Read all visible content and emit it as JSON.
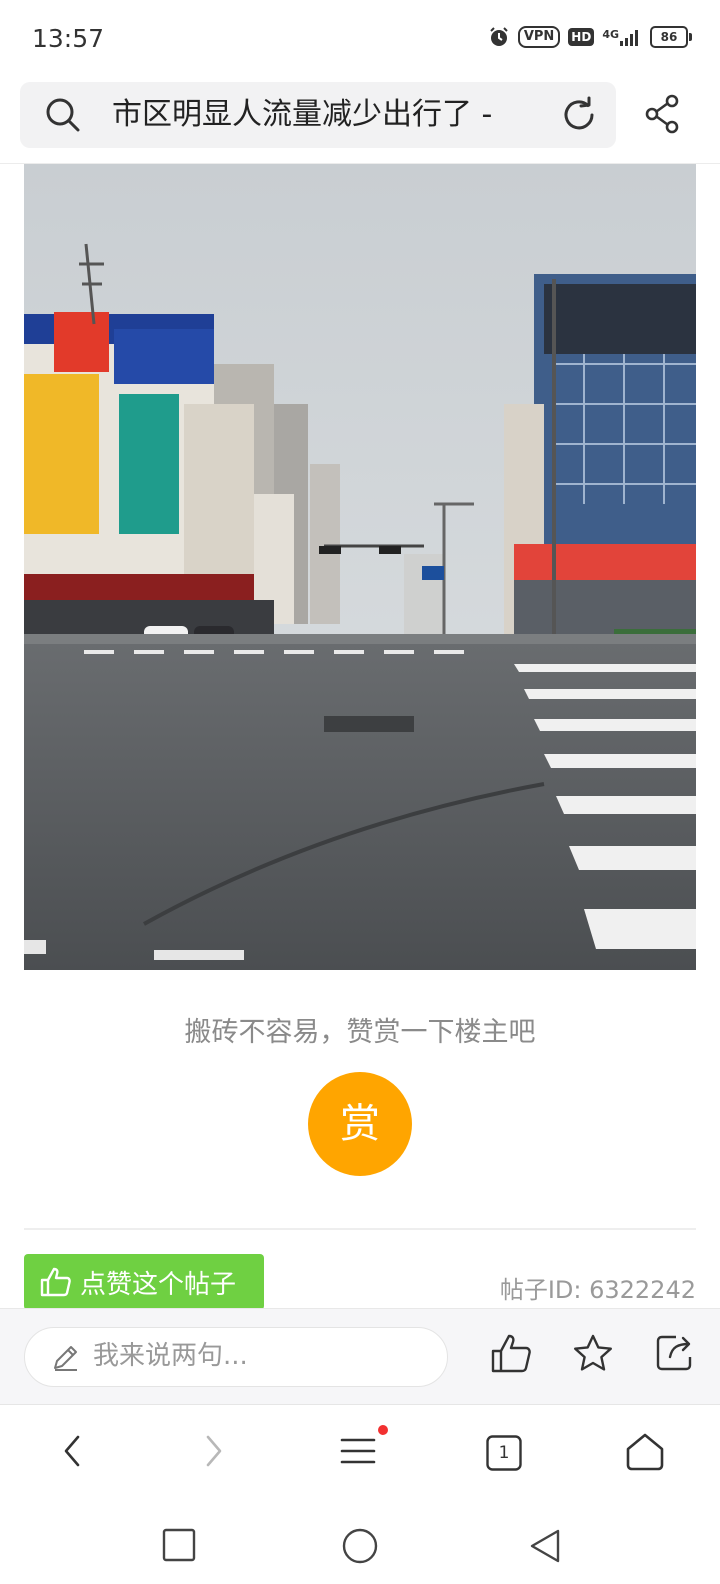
{
  "status_bar": {
    "time": "13:57",
    "vpn_label": "VPN",
    "hd_label": "HD",
    "network_label": "4G",
    "battery_level": "86",
    "icons": [
      "alarm-icon",
      "vpn-icon",
      "hd-icon",
      "signal-icon",
      "battery-icon"
    ]
  },
  "browser": {
    "url_text": "市区明显人流量减少出行了 -",
    "icons": [
      "search-icon",
      "reload-icon",
      "share-icon"
    ]
  },
  "post": {
    "image_alt": "城市街道十字路口照片",
    "reward_prompt": "搬砖不容易，赞赏一下楼主吧",
    "reward_button": "赏",
    "like_post_label": "点赞这个帖子",
    "post_id": "帖子ID: 6322242",
    "colors": {
      "reward": "#ffa500",
      "like_post": "#6fd042"
    }
  },
  "comment_bar": {
    "placeholder": "我来说两句...",
    "icons": [
      "pencil-icon",
      "thumbs-up-icon",
      "star-icon",
      "share-out-icon"
    ]
  },
  "browser_nav": {
    "tab_count": "1",
    "icons": [
      "back-icon",
      "forward-icon",
      "menu-icon",
      "tabs-icon",
      "home-icon"
    ]
  },
  "system_nav": {
    "icons": [
      "recents-icon",
      "home-circle-icon",
      "back-triangle-icon"
    ]
  }
}
